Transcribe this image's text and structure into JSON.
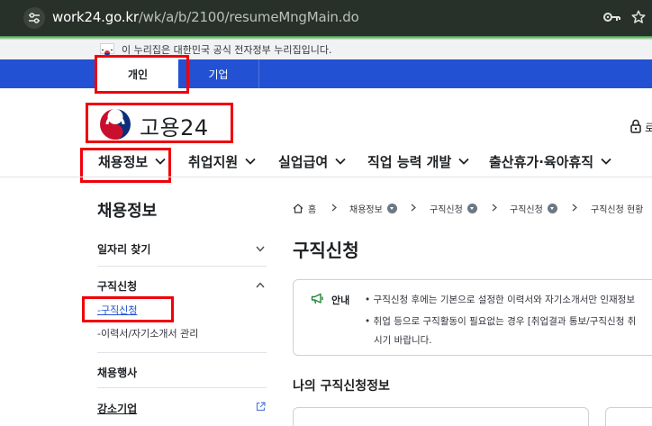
{
  "browser": {
    "url_host": "work24.go.kr",
    "url_path": "/wk/a/b/2100/resumeMngMain.do"
  },
  "gov_banner": {
    "text": "이 누리집은 대한민국 공식 전자정부 누리집입니다."
  },
  "user_tabs": [
    {
      "label": "개인",
      "selected": true
    },
    {
      "label": "기업",
      "selected": false
    }
  ],
  "logo": {
    "text": "고용24"
  },
  "header_right": {
    "label": "로"
  },
  "gnb": [
    {
      "label": "채용정보"
    },
    {
      "label": "취업지원"
    },
    {
      "label": "실업급여"
    },
    {
      "label": "직업 능력 개발"
    },
    {
      "label": "출산휴가·육아휴직"
    }
  ],
  "lnb": {
    "title": "채용정보",
    "items": [
      {
        "label": "일자리 찾기"
      },
      {
        "label": "구직신청"
      },
      {
        "label": "채용행사"
      },
      {
        "label": "강소기업"
      }
    ],
    "sub_items": [
      {
        "label": "구직신청",
        "prefix": "-",
        "active": true
      },
      {
        "label": "이력서/자기소개서 관리",
        "prefix": "-",
        "active": false
      }
    ]
  },
  "breadcrumb": [
    {
      "label": "홈"
    },
    {
      "label": "채용정보"
    },
    {
      "label": "구직신청"
    },
    {
      "label": "구직신청"
    },
    {
      "label": "구직신청 현황"
    }
  ],
  "page": {
    "title": "구직신청",
    "notice_label": "안내",
    "notice_lines": [
      "• 구직신청 후에는 기본으로 설정한 이력서와 자기소개서만 인재정보",
      "• 취업 등으로 구직활동이 필요없는 경우 [취업결과 통보/구직신청 취",
      "시기 바랍니다."
    ],
    "section_title": "나의 구직신청정보"
  },
  "colors": {
    "brand_blue": "#2252d3",
    "highlight_red": "#f0000a",
    "address_bar": "#28302a"
  }
}
